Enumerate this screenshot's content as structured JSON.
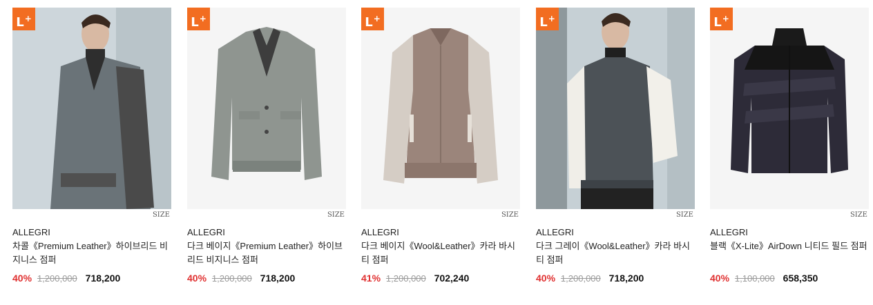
{
  "products": [
    {
      "badge": "L",
      "size_label": "SIZE",
      "brand": "ALLEGRI",
      "title": "차콜《Premium Leather》하이브리드 비지니스 점퍼",
      "discount": "40%",
      "original_price": "1,200,000",
      "sale_price": "718,200"
    },
    {
      "badge": "L",
      "size_label": "SIZE",
      "brand": "ALLEGRI",
      "title": "다크 베이지《Premium Leather》하이브리드 비지니스 점퍼",
      "discount": "40%",
      "original_price": "1,200,000",
      "sale_price": "718,200"
    },
    {
      "badge": "L",
      "size_label": "SIZE",
      "brand": "ALLEGRI",
      "title": "다크 베이지《Wool&Leather》카라 바시티 점퍼",
      "discount": "41%",
      "original_price": "1,200,000",
      "sale_price": "702,240"
    },
    {
      "badge": "L",
      "size_label": "SIZE",
      "brand": "ALLEGRI",
      "title": "다크 그레이《Wool&Leather》카라 바시티 점퍼",
      "discount": "40%",
      "original_price": "1,200,000",
      "sale_price": "718,200"
    },
    {
      "badge": "L",
      "size_label": "SIZE",
      "brand": "ALLEGRI",
      "title": "블랙《X-Lite》AirDown 니티드 필드 점퍼",
      "discount": "40%",
      "original_price": "1,100,000",
      "sale_price": "658,350"
    }
  ],
  "colors": {
    "badge": "#f26d21",
    "discount": "#e03131"
  }
}
